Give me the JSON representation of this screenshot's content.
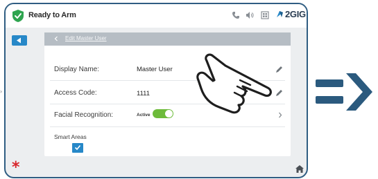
{
  "status": {
    "text": "Ready to Arm",
    "brand": "2GIG"
  },
  "header": {
    "title": "Edit Master User"
  },
  "fields": [
    {
      "label": "Display Name:",
      "value": "Master User"
    },
    {
      "label": "Access Code:",
      "value": "1111"
    },
    {
      "label": "Facial Recognition:",
      "value": "Active"
    }
  ],
  "smart_areas": {
    "label": "Smart Areas",
    "checked": true
  },
  "facial_recognition_toggle": {
    "on": true
  },
  "colors": {
    "frame": "#2f5d82",
    "accent_blue": "#2788c8",
    "toggle_green": "#6dbb3a",
    "alarm_red": "#d8262c",
    "shield_green": "#2ea44f",
    "arrow_navy": "#2b5a7e"
  },
  "icons": [
    "shield-check-icon",
    "phone-icon",
    "speaker-icon",
    "grid-icon",
    "brand-logo-icon",
    "back-arrow-icon",
    "pencil-icon",
    "chevron-right-icon",
    "hand-pointer-icon",
    "asterisk-icon",
    "home-icon",
    "double-arrow-icon"
  ]
}
